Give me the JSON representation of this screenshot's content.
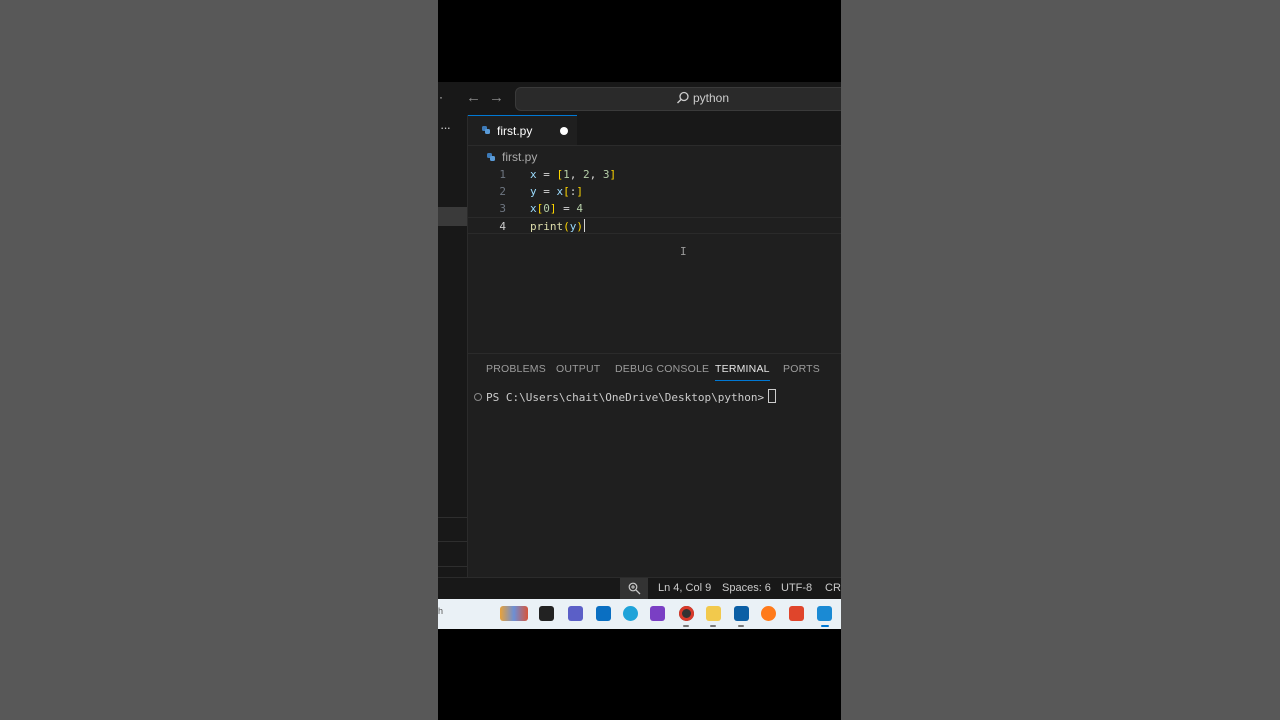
{
  "titlebar": {
    "search_text": "python",
    "menu_icon": "ellipsis-icon",
    "back_icon": "arrow-left-icon",
    "forward_icon": "arrow-right-icon"
  },
  "tabs": [
    {
      "label": "first.py",
      "icon": "python-icon",
      "modified": true
    }
  ],
  "breadcrumb": {
    "label": "first.py",
    "icon": "python-icon"
  },
  "editor": {
    "current_line": 4,
    "lines": [
      {
        "num": "1",
        "code": "x = [1, 2, 3]"
      },
      {
        "num": "2",
        "code": "y = x[:]"
      },
      {
        "num": "3",
        "code": "x[0] = 4"
      },
      {
        "num": "4",
        "code": "print(y)"
      }
    ]
  },
  "panel": {
    "tabs": [
      "PROBLEMS",
      "OUTPUT",
      "DEBUG CONSOLE",
      "TERMINAL",
      "PORTS"
    ],
    "active_tab": "TERMINAL",
    "terminal_prompt": "PS C:\\Users\\chait\\OneDrive\\Desktop\\python>"
  },
  "statusbar": {
    "position": "Ln 4, Col 9",
    "spaces": "Spaces: 6",
    "encoding": "UTF-8",
    "eol": "CRLF"
  },
  "taskbar": {
    "left_text": "h",
    "icons": [
      "files-icon",
      "terminal-icon",
      "teams-icon",
      "dell-icon",
      "edge-icon",
      "clapper-icon",
      "chrome-icon",
      "folder-icon",
      "store-icon",
      "firefox-icon",
      "brave-icon",
      "vscode-icon"
    ]
  },
  "colors": {
    "accent": "#0078d4",
    "editor_bg": "#1f1f1f",
    "bracket": "#ffd700",
    "variable": "#9cdcfe",
    "number": "#b5cea8",
    "function": "#dcdcaa"
  }
}
